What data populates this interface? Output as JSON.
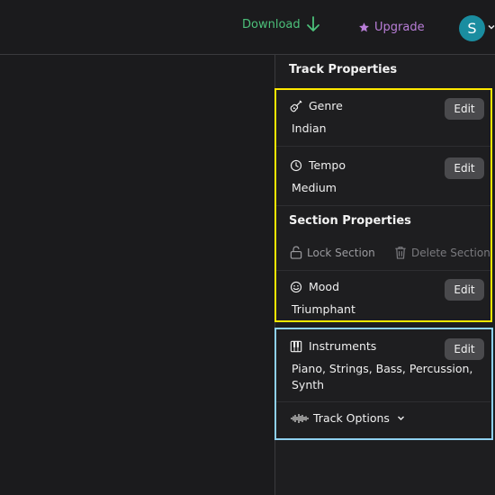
{
  "header": {
    "download_label": "Download",
    "upgrade_label": "Upgrade",
    "avatar_initial": "S"
  },
  "panel": {
    "track_title": "Track Properties",
    "genre": {
      "label": "Genre",
      "value": "Indian",
      "edit_label": "Edit",
      "icon": "guitar-icon"
    },
    "tempo": {
      "label": "Tempo",
      "value": "Medium",
      "edit_label": "Edit",
      "icon": "clock-icon"
    },
    "section_title": "Section Properties",
    "lock_section_label": "Lock Section",
    "delete_section_label": "Delete Section",
    "mood": {
      "label": "Mood",
      "value": "Triumphant",
      "edit_label": "Edit",
      "icon": "smiley-icon"
    },
    "instruments": {
      "label": "Instruments",
      "value_line1": "Piano, Strings, Bass, Percussion,",
      "value_line2": "Synth",
      "edit_label": "Edit",
      "icon": "piano-icon"
    },
    "track_options_label": "Track Options"
  },
  "colors": {
    "background": "#1b1b1d",
    "download": "#4cc07a",
    "upgrade": "#b97ed8",
    "avatar": "#1a8da0",
    "highlight_yellow": "#ffe800",
    "highlight_blue": "#8fd1ef",
    "edit_button": "#4a4a4d"
  }
}
